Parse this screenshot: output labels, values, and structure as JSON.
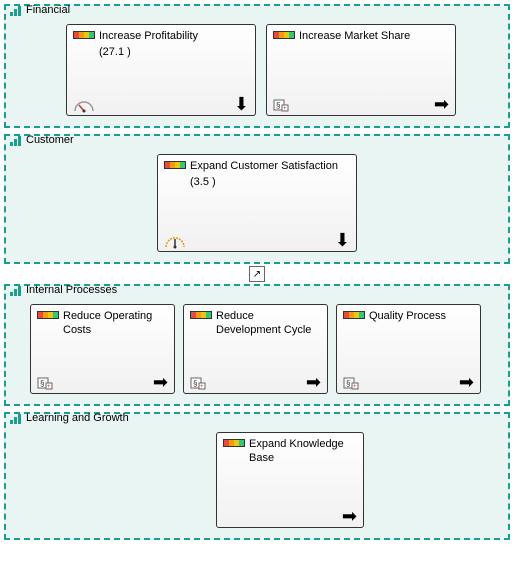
{
  "perspectives": [
    {
      "id": "financial",
      "title": "Financial",
      "cards": [
        {
          "title": "Increase Profitability",
          "value": "(27.1 )",
          "arrow": "down",
          "footer": "gauge"
        },
        {
          "title": "Increase Market Share",
          "value": "",
          "arrow": "right",
          "footer": "action"
        }
      ]
    },
    {
      "id": "customer",
      "title": "Customer",
      "cards": [
        {
          "title": "Expand Customer Satisfaction",
          "value": "(3.5 )",
          "arrow": "down",
          "footer": "gauge2"
        }
      ]
    },
    {
      "id": "internal",
      "title": "Internal Processes",
      "cards": [
        {
          "title": "Reduce Operating Costs",
          "value": "",
          "arrow": "right",
          "footer": "action"
        },
        {
          "title": "Reduce Development Cycle",
          "value": "",
          "arrow": "right",
          "footer": "action"
        },
        {
          "title": "Quality Process",
          "value": "",
          "arrow": "right",
          "footer": "action"
        }
      ]
    },
    {
      "id": "learning",
      "title": "Learning and Growth",
      "cards": [
        {
          "title": "Expand Knowledge Base",
          "value": "",
          "arrow": "right",
          "footer": "none"
        }
      ]
    }
  ],
  "connector_glyph": "↗"
}
